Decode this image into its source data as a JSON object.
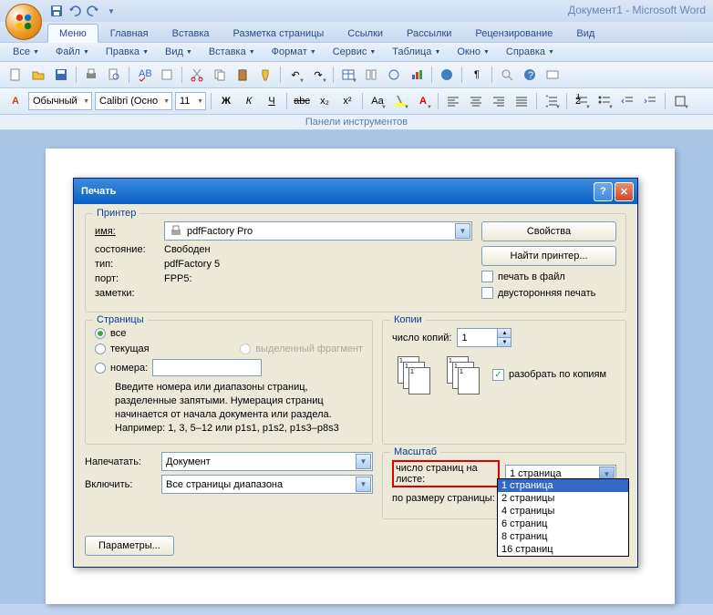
{
  "window_title": "Документ1 - Microsoft Word",
  "tabs": {
    "menu": "Меню",
    "home": "Главная",
    "insert": "Вставка",
    "layout": "Разметка страницы",
    "refs": "Ссылки",
    "mail": "Рассылки",
    "review": "Рецензирование",
    "view": "Вид"
  },
  "menubar": {
    "all": "Все",
    "file": "Файл",
    "edit": "Правка",
    "view": "Вид",
    "insert": "Вставка",
    "format": "Формат",
    "tools": "Сервис",
    "table": "Таблица",
    "window": "Окно",
    "help": "Справка"
  },
  "toolbar": {
    "style": "Обычный",
    "font": "Calibri (Осно",
    "size": "11"
  },
  "panels_label": "Панели инструментов",
  "dialog": {
    "title": "Печать",
    "printer": {
      "legend": "Принтер",
      "name_lbl": "имя:",
      "name_val": "pdfFactory Pro",
      "state_lbl": "состояние:",
      "state_val": "Свободен",
      "type_lbl": "тип:",
      "type_val": "pdfFactory 5",
      "port_lbl": "порт:",
      "port_val": "FPP5:",
      "notes_lbl": "заметки:",
      "props_btn": "Свойства",
      "find_btn": "Найти принтер...",
      "to_file": "печать в файл",
      "duplex": "двусторонняя печать"
    },
    "pages": {
      "legend": "Страницы",
      "all": "все",
      "current": "текущая",
      "selection": "выделенный фрагмент",
      "numbers": "номера:",
      "hint": "Введите номера или диапазоны страниц, разделенные запятыми. Нумерация страниц начинается от начала документа или раздела. Например: 1, 3, 5–12 или p1s1, p1s2, p1s3–p8s3"
    },
    "copies": {
      "legend": "Копии",
      "count_lbl": "число копий:",
      "count_val": "1",
      "collate": "разобрать по копиям"
    },
    "print_what_lbl": "Напечатать:",
    "print_what_val": "Документ",
    "include_lbl": "Включить:",
    "include_val": "Все страницы диапазона",
    "scale": {
      "legend": "Масштаб",
      "ppp_lbl": "число страниц на листе:",
      "ppp_val": "1 страница",
      "fit_lbl": "по размеру страницы:",
      "options": [
        "1 страница",
        "2 страницы",
        "4 страницы",
        "6 страниц",
        "8 страниц",
        "16 страниц"
      ]
    },
    "params_btn": "Параметры..."
  }
}
